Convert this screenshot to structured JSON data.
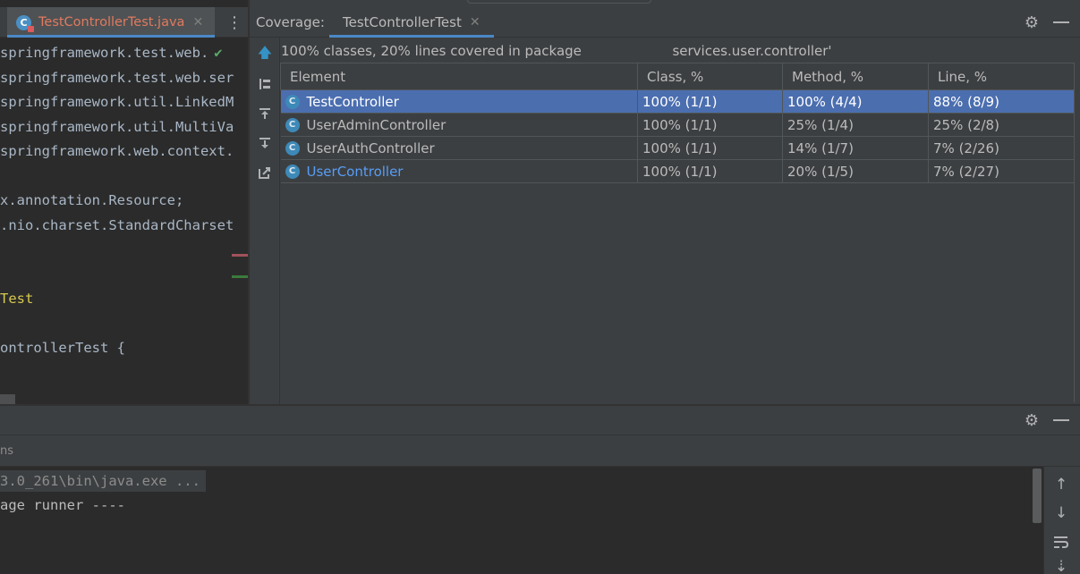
{
  "editor": {
    "tab_label": "TestControllerTest.java",
    "lines": [
      {
        "text": "springframework.test.web.",
        "check": true
      },
      {
        "text": "springframework.test.web.ser",
        "check": false
      },
      {
        "text": "springframework.util.LinkedM",
        "check": false
      },
      {
        "text": "springframework.util.MultiVa",
        "check": false
      },
      {
        "text": "springframework.web.context.",
        "check": false
      },
      {
        "text": "",
        "check": false
      },
      {
        "text": "x.annotation.Resource;",
        "check": false
      },
      {
        "text": ".nio.charset.StandardCharset",
        "check": false
      },
      {
        "text": "",
        "check": false
      },
      {
        "text": "",
        "check": false
      },
      {
        "text": "Test",
        "check": false
      },
      {
        "text": "",
        "check": false
      },
      {
        "text": "ontrollerTest {",
        "check": false
      }
    ]
  },
  "coverage": {
    "title": "Coverage:",
    "tab_label": "TestControllerTest",
    "summary_prefix": "100% classes, 20% lines covered in package",
    "summary_suffix": "services.user.controller'",
    "columns": [
      "Element",
      "Class, %",
      "Method, %",
      "Line, %"
    ],
    "rows": [
      {
        "element": "TestController",
        "class": "100% (1/1)",
        "method": "100% (4/4)",
        "line": "88% (8/9)",
        "selected": true
      },
      {
        "element": "UserAdminController",
        "class": "100% (1/1)",
        "method": "25% (1/4)",
        "line": "25% (2/8)",
        "selected": false
      },
      {
        "element": "UserAuthController",
        "class": "100% (1/1)",
        "method": "14% (1/7)",
        "line": "7% (2/26)",
        "selected": false
      },
      {
        "element": "UserController",
        "class": "100% (1/1)",
        "method": "20% (1/5)",
        "line": "7% (2/27)",
        "selected": false
      }
    ]
  },
  "run": {
    "tab_label": "ns",
    "console": [
      "3.0_261\\bin\\java.exe ...",
      "age runner ----"
    ]
  },
  "colors": {
    "accent": "#4a88c7",
    "selection": "#4b6eaf",
    "tab_file_text": "#e07a5f",
    "link": "#589df6"
  }
}
